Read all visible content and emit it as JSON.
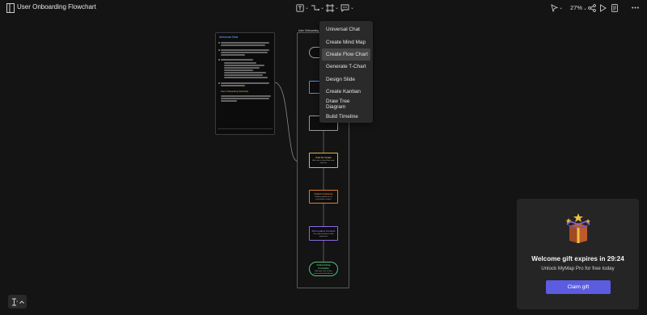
{
  "header": {
    "title": "User Onboarding Flowchart",
    "zoom": "27%"
  },
  "menu": {
    "items": [
      {
        "label": "Universal Chat",
        "active": false
      },
      {
        "label": "Create Mind Map",
        "active": false
      },
      {
        "label": "Create Flow Chart",
        "active": true
      },
      {
        "label": "Generate T-Chart",
        "active": false
      },
      {
        "label": "Design Slide",
        "active": false
      },
      {
        "label": "Create Kanban",
        "active": false
      },
      {
        "label": "Draw Tree Diagram",
        "active": false
      },
      {
        "label": "Build Timeline",
        "active": false
      }
    ]
  },
  "chat_card": {
    "title": "Universal Chat",
    "subheading": "User Onboarding Flowchart"
  },
  "flowchart": {
    "title": "User Onboarding Fl",
    "nodes": [
      {
        "title": "Start",
        "desc": "",
        "color": "#9a9a9a"
      },
      {
        "title": "",
        "desc": "",
        "color": "#4f8df0"
      },
      {
        "title": "",
        "desc": "",
        "color": "#9a9a9a"
      },
      {
        "title": "Ask for Goals",
        "desc": "Ask user to share their main objective",
        "color": "#e6b44c"
      },
      {
        "title": "Collect Interests",
        "desc": "Gather preferences to personalize content",
        "color": "#e07a3a"
      },
      {
        "title": "Personalize Content",
        "desc": "Use collected data to tailor experience",
        "color": "#8a6be0"
      },
      {
        "title": "Onboarding Complete",
        "desc": "Welcome user to their personalized dashboard",
        "color": "#4fc07a"
      }
    ]
  },
  "gift": {
    "title": "Welcome gift expires in 29:24",
    "subtitle": "Unlock MyMap Pro for free today",
    "button": "Claim gift"
  },
  "colors": {
    "background": "#141414",
    "accent": "#5b5ce0",
    "card": "#252525"
  }
}
